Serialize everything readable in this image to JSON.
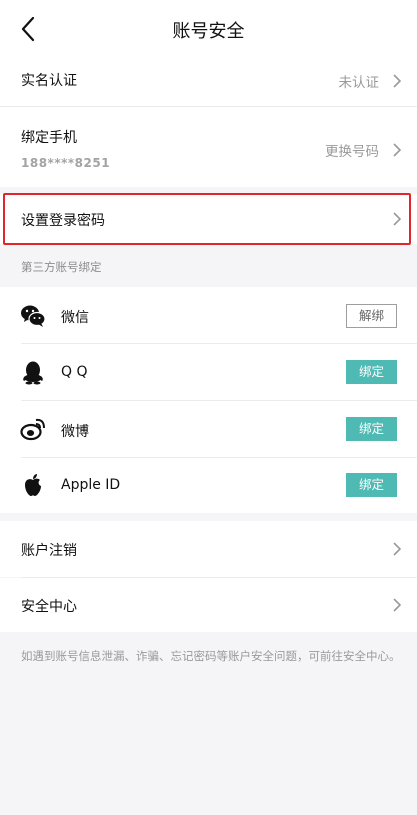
{
  "nav": {
    "title": "账号安全"
  },
  "realname": {
    "label": "实名认证",
    "value": "未认证"
  },
  "phone": {
    "label": "绑定手机",
    "number": "188****8251",
    "action": "更换号码"
  },
  "password": {
    "label": "设置登录密码"
  },
  "thirdparty": {
    "header": "第三方账号绑定",
    "items": [
      {
        "name": "微信",
        "icon": "wechat-icon",
        "button": "解绑",
        "bound": true
      },
      {
        "name": "Q Q",
        "icon": "qq-icon",
        "button": "绑定",
        "bound": false
      },
      {
        "name": "微博",
        "icon": "weibo-icon",
        "button": "绑定",
        "bound": false
      },
      {
        "name": "Apple ID",
        "icon": "apple-icon",
        "button": "绑定",
        "bound": false
      }
    ]
  },
  "account": {
    "cancel_label": "账户注销",
    "security_center_label": "安全中心"
  },
  "footer": {
    "note": "如遇到账号信息泄漏、诈骗、忘记密码等账户安全问题，可前往安全中心。"
  },
  "colors": {
    "highlight": "#e1262b",
    "bind_button": "#4fb9b4"
  }
}
